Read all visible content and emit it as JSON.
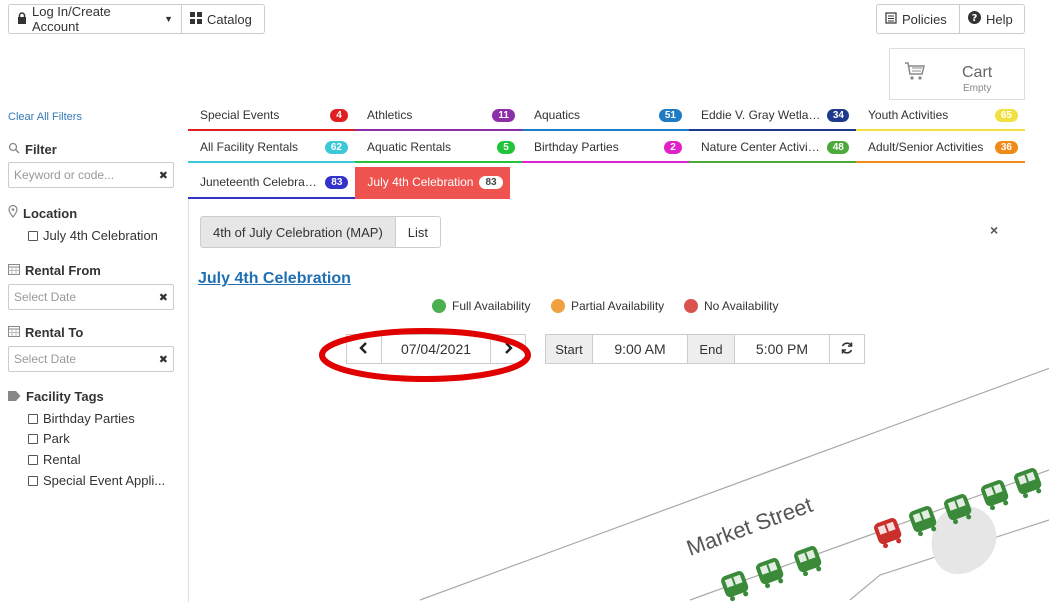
{
  "topbar": {
    "login_label": "Log In/Create Account",
    "catalog_label": "Catalog",
    "policies_label": "Policies",
    "help_label": "Help"
  },
  "cart": {
    "label": "Cart",
    "status": "Empty"
  },
  "sidebar": {
    "clear_filters": "Clear All Filters",
    "filter_heading": "Filter",
    "keyword_placeholder": "Keyword or code...",
    "location_heading": "Location",
    "location_items": [
      "July 4th Celebration"
    ],
    "rental_from_heading": "Rental From",
    "rental_from_placeholder": "Select Date",
    "rental_to_heading": "Rental To",
    "rental_to_placeholder": "Select Date",
    "tags_heading": "Facility Tags",
    "tags": [
      "Birthday Parties",
      "Park",
      "Rental",
      "Special Event Appli..."
    ]
  },
  "tabs": [
    {
      "name": "Special Events",
      "count": "4",
      "color": "#e02020"
    },
    {
      "name": "Athletics",
      "count": "11",
      "color": "#8e2ea8"
    },
    {
      "name": "Aquatics",
      "count": "51",
      "color": "#1e7bc4"
    },
    {
      "name": "Eddie V. Gray Wetland...",
      "count": "34",
      "color": "#1f3a8c"
    },
    {
      "name": "Youth Activities",
      "count": "65",
      "color": "#f0e040"
    },
    {
      "name": "All Facility Rentals",
      "count": "62",
      "color": "#3cc8d8"
    },
    {
      "name": "Aquatic Rentals",
      "count": "5",
      "color": "#22c43a"
    },
    {
      "name": "Birthday Parties",
      "count": "2",
      "color": "#e020c8"
    },
    {
      "name": "Nature Center Activitie...",
      "count": "48",
      "color": "#4caa3a"
    },
    {
      "name": "Adult/Senior Activities",
      "count": "36",
      "color": "#f08a18"
    },
    {
      "name": "Juneteenth Celebration",
      "count": "83",
      "color": "#3333cc"
    },
    {
      "name": "July 4th Celebration",
      "count": "83",
      "color": "#ef5350"
    }
  ],
  "view_toggle": {
    "map_label": "4th of July Celebration (MAP)",
    "list_label": "List"
  },
  "close_symbol": "×",
  "location_title": "July 4th Celebration",
  "legend": {
    "full": "Full Availability",
    "partial": "Partial Availability",
    "none": "No Availability",
    "full_color": "#4caf50",
    "partial_color": "#f0a040",
    "none_color": "#d9534f"
  },
  "datebar": {
    "date": "07/04/2021",
    "start_label": "Start",
    "start_time": "9:00 AM",
    "end_label": "End",
    "end_time": "5:00 PM"
  },
  "map": {
    "street_label": "Market Street"
  }
}
